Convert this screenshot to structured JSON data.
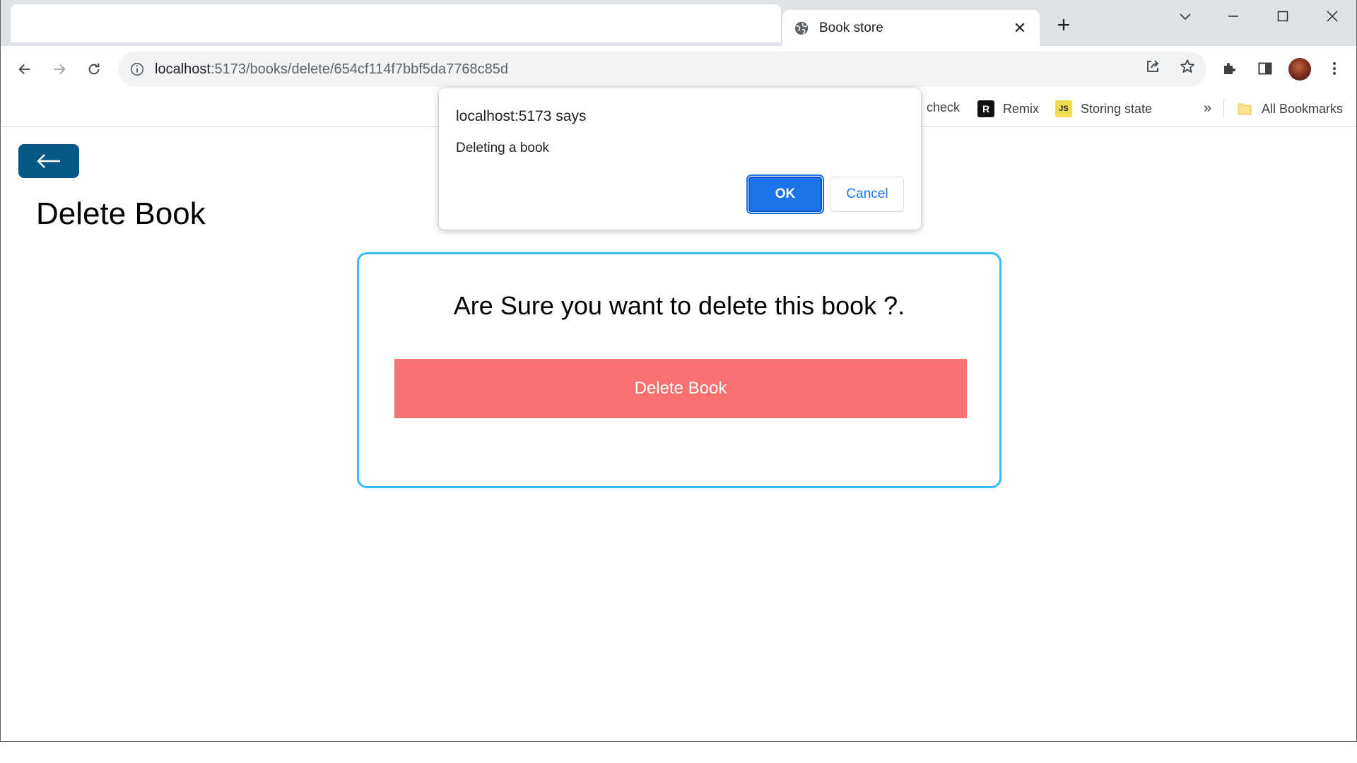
{
  "browser": {
    "tab_title": "Book store",
    "tab_close": "✕",
    "new_tab": "+",
    "url_host": "localhost",
    "url_rest": ":5173/books/delete/654cf114f7bbf5da7768c85d",
    "icons": {
      "back": "back-arrow-icon",
      "forward": "forward-arrow-icon",
      "reload": "reload-icon",
      "site_info": "info-icon",
      "share": "share-icon",
      "bookmark": "star-icon",
      "extensions": "puzzle-icon",
      "side_panel": "side-panel-icon",
      "menu": "kebab-menu-icon"
    }
  },
  "bookmarks": {
    "items": [
      {
        "label": "check",
        "icon": "none"
      },
      {
        "label": "Remix",
        "icon": "remix-icon",
        "icon_text": "R"
      },
      {
        "label": "Storing state",
        "icon": "js-icon",
        "icon_text": "JS"
      }
    ],
    "overflow": "»",
    "all_bookmarks": "All Bookmarks"
  },
  "page": {
    "title": "Delete Book",
    "question": "Are Sure you want to delete this book ?.",
    "delete_button": "Delete Book"
  },
  "dialog": {
    "title": "localhost:5173 says",
    "message": "Deleting a book",
    "ok": "OK",
    "cancel": "Cancel"
  },
  "colors": {
    "back_button": "#075985",
    "card_border": "#38bdf8",
    "delete_button": "#f87171",
    "dialog_ok": "#1a73e8"
  }
}
